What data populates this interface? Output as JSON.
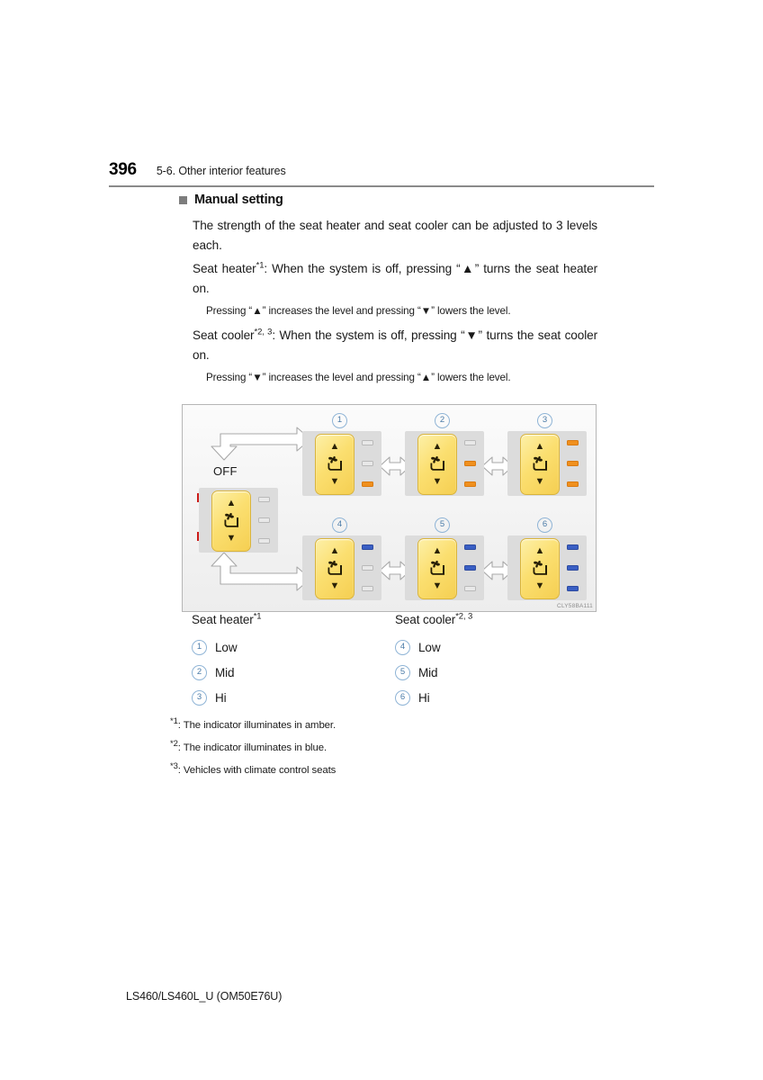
{
  "header": {
    "page_number": "396",
    "section": "5-6. Other interior features"
  },
  "heading": {
    "manual_setting": "Manual setting"
  },
  "body": {
    "p1": "The strength of the seat heater and seat cooler can be adjusted to 3 levels each.",
    "p2_a": "Seat heater",
    "p2_fn": "*1",
    "p2_b": ": When the system is off, pressing “▲” turns the seat heater on.",
    "p2_sub_a": "Pressing “▲” increases the level and pressing “▼” lowers the level.",
    "p3_a": "Seat cooler",
    "p3_fn": "*2, 3",
    "p3_b": ": When the system is off, pressing “▼” turns the seat cooler on.",
    "p3_sub_a": "Pressing “▼” increases the level and pressing “▲” lowers the level."
  },
  "figure": {
    "code": "CLY58BA111",
    "off_label": "OFF",
    "up_arrow_glyph": "▲",
    "down_arrow_glyph": "▼",
    "switches": [
      {
        "id": "off",
        "step": "",
        "lamps": [
          "off",
          "off",
          "off"
        ]
      },
      {
        "id": "1",
        "step": "1",
        "lamps": [
          "off",
          "off",
          "amber"
        ]
      },
      {
        "id": "2",
        "step": "2",
        "lamps": [
          "off",
          "amber",
          "amber"
        ]
      },
      {
        "id": "3",
        "step": "3",
        "lamps": [
          "amber",
          "amber",
          "amber"
        ]
      },
      {
        "id": "4",
        "step": "4",
        "lamps": [
          "blue",
          "off",
          "off"
        ]
      },
      {
        "id": "5",
        "step": "5",
        "lamps": [
          "blue",
          "blue",
          "off"
        ]
      },
      {
        "id": "6",
        "step": "6",
        "lamps": [
          "blue",
          "blue",
          "blue"
        ]
      }
    ],
    "colors": {
      "amber": "#f0901e",
      "blue": "#3a5fc4",
      "lamp_off": "#e8e8e8",
      "switch_yellow": "#fbdf70",
      "red_arrow": "#cc1c19",
      "panel_gray": "#dcdcdc",
      "step_circle": "#8fb4d6"
    }
  },
  "legend": {
    "left": {
      "title_a": "Seat heater",
      "title_fn": "*1",
      "rows": [
        {
          "num": "1",
          "label": "Low"
        },
        {
          "num": "2",
          "label": "Mid"
        },
        {
          "num": "3",
          "label": "Hi"
        }
      ]
    },
    "right": {
      "title_a": "Seat cooler",
      "title_fn": "*2, 3",
      "rows": [
        {
          "num": "4",
          "label": "Low"
        },
        {
          "num": "5",
          "label": "Mid"
        },
        {
          "num": "6",
          "label": "Hi"
        }
      ]
    }
  },
  "footnotes": [
    {
      "mark": "*1",
      "text": ": The indicator illuminates in amber."
    },
    {
      "mark": "*2",
      "text": ": The indicator illuminates in blue."
    },
    {
      "mark": "*3",
      "text": ": Vehicles with climate control seats"
    }
  ],
  "footer": {
    "text": "LS460/LS460L_U (OM50E76U)"
  }
}
